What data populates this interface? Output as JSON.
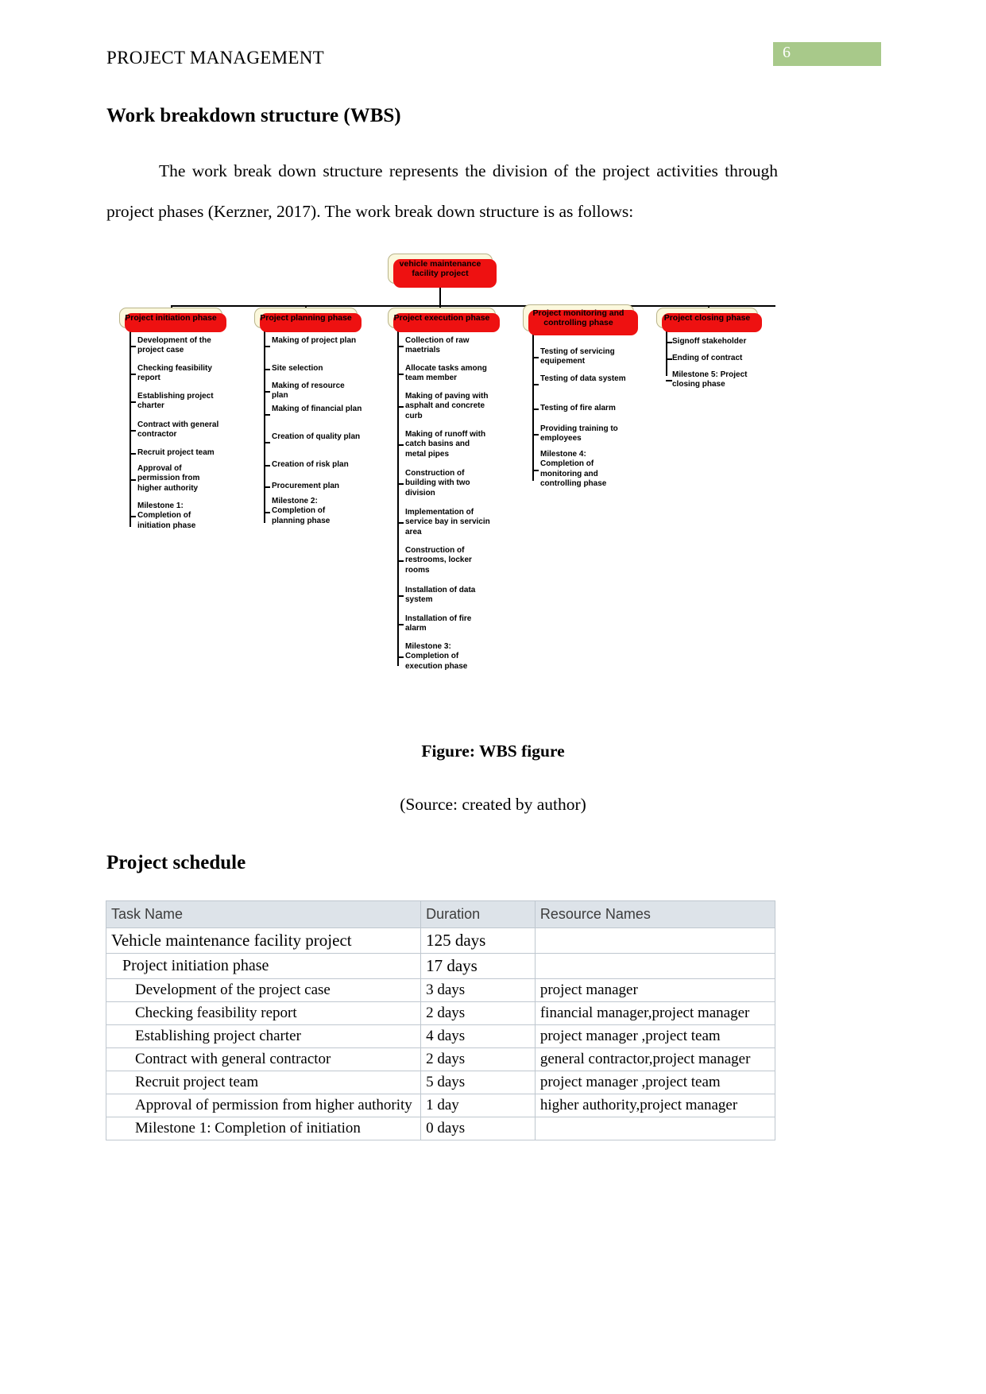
{
  "header": {
    "running_head": "PROJECT MANAGEMENT",
    "page_number": "6",
    "page_number_bg": "#a8c98a"
  },
  "sections": {
    "wbs_heading": "Work breakdown structure (WBS)",
    "wbs_paragraph": "The work break down structure represents the division of the project activities through project phases (Kerzner, 2017). The work break down structure is as follows:",
    "figure_caption": "Figure: WBS figure",
    "figure_source": "(Source: created by author)",
    "schedule_heading": "Project schedule"
  },
  "wbs": {
    "root": "vehicle maintenance facility project",
    "node_fill": "#fbf8dd",
    "node_shadow": "#ee1111",
    "branches": [
      {
        "title": "Project initiation phase",
        "items": [
          "Development of the project case",
          "Checking feasibility report",
          "Establishing project charter",
          "Contract with general contractor",
          "Recruit project team",
          "Approval of permission from higher authority",
          "Milestone 1: Completion of initiation phase"
        ]
      },
      {
        "title": "Project planning phase",
        "items": [
          "Making of project plan",
          "Site selection",
          "Making of resource plan",
          "Making of financial plan",
          "Creation of quality plan",
          "Creation of risk plan",
          "Procurement plan",
          "Milestone 2: Completion of planning phase"
        ]
      },
      {
        "title": "Project execution phase",
        "items": [
          "Collection of raw maetrials",
          "Allocate tasks among team member",
          "Making of paving with asphalt and concrete curb",
          "Making of runoff with catch basins and metal pipes",
          "Construction of building with two division",
          "Implementation of service bay in servicin area",
          "Construction of restrooms, locker rooms",
          "Installation of data system",
          "Installation of fire alarm",
          "Milestone 3: Completion of execution phase"
        ]
      },
      {
        "title": "Project monitoring and controlling phase",
        "items": [
          "Testing of servicing equipement",
          "Testing of data system",
          "Testing of fire alarm",
          "Providing training to employees",
          "Milestone 4: Completion of monitoring and controlling phase"
        ]
      },
      {
        "title": "Project closing phase",
        "items": [
          "Signoff stakeholder",
          "Ending of contract",
          "Milestone 5: Project closing phase"
        ]
      }
    ]
  },
  "schedule": {
    "columns": [
      "Task Name",
      "Duration",
      "Resource Names"
    ],
    "header_bg": "#dde3e9",
    "rows": [
      {
        "level": 0,
        "task": "Vehicle maintenance facility project",
        "duration": "125 days",
        "resources": ""
      },
      {
        "level": 1,
        "task": "Project initiation phase",
        "duration": "17 days",
        "resources": ""
      },
      {
        "level": 2,
        "task": "Development of the project case",
        "duration": "3 days",
        "resources": "project manager"
      },
      {
        "level": 2,
        "task": "Checking feasibility report",
        "duration": "2 days",
        "resources": "financial manager,project manager"
      },
      {
        "level": 2,
        "task": "Establishing project charter",
        "duration": "4 days",
        "resources": "project manager ,project team"
      },
      {
        "level": 2,
        "task": "Contract with general contractor",
        "duration": "2 days",
        "resources": "general contractor,project manager"
      },
      {
        "level": 2,
        "task": "Recruit project team",
        "duration": "5 days",
        "resources": "project manager ,project team"
      },
      {
        "level": 2,
        "task": "Approval of permission from higher authority",
        "duration": "1 day",
        "resources": "higher authority,project manager"
      },
      {
        "level": 2,
        "task": "Milestone 1: Completion of initiation",
        "duration": "0 days",
        "resources": ""
      }
    ]
  }
}
